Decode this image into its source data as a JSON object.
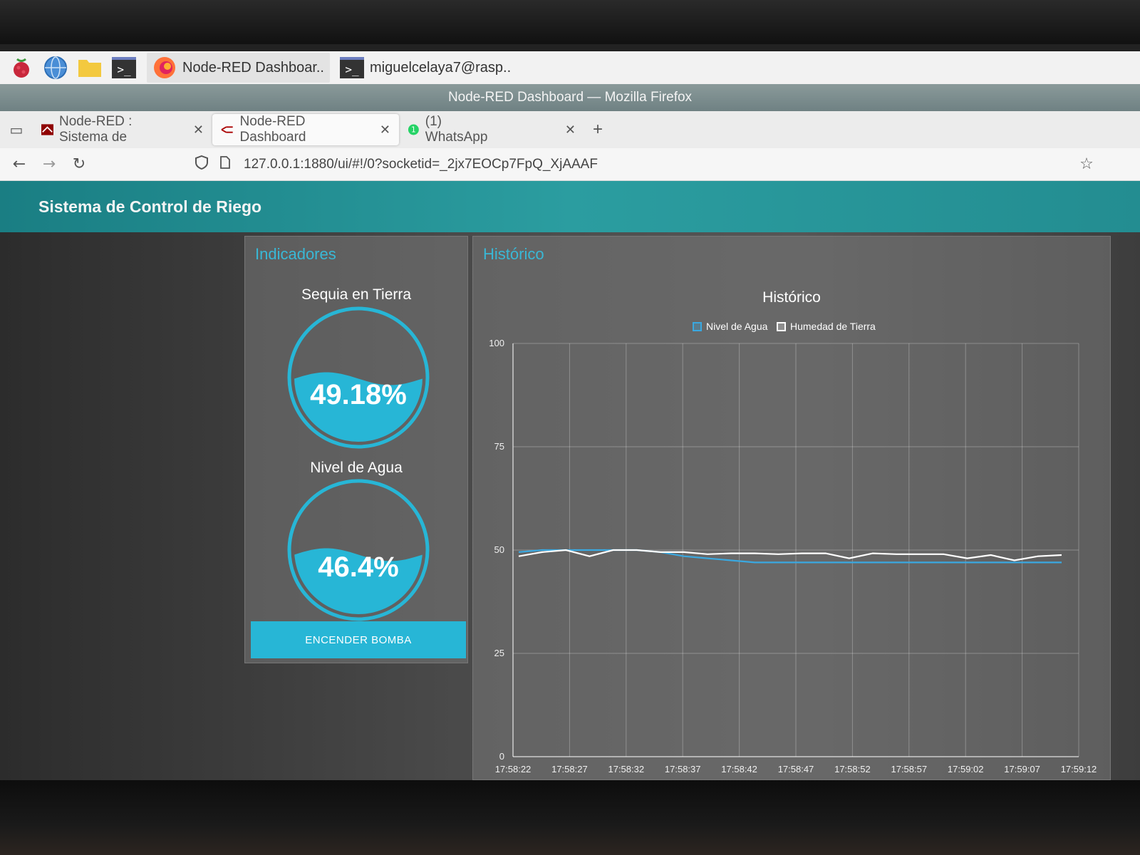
{
  "taskbar": {
    "firefox_item": "Node-RED Dashboar..",
    "terminal_item": "miguelcelaya7@rasp.."
  },
  "window_title": "Node-RED Dashboard — Mozilla Firefox",
  "tabs": [
    {
      "label": "Node-RED : Sistema de"
    },
    {
      "label": "Node-RED Dashboard"
    },
    {
      "label": "(1) WhatsApp"
    }
  ],
  "url": "127.0.0.1:1880/ui/#!/0?socketid=_2jx7EOCp7FpQ_XjAAAF",
  "dashboard": {
    "title": "Sistema de Control de Riego",
    "indicators_title": "Indicadores",
    "gauges": [
      {
        "label": "Sequia en Tierra",
        "value": "49.18%",
        "level": 49.18
      },
      {
        "label": "Nivel de Agua",
        "value": "46.4%",
        "level": 46.4
      }
    ],
    "pump_button": "ENCENDER BOMBA",
    "history_group_title": "Histórico"
  },
  "colors": {
    "accent": "#27b6d6",
    "header": "#2b9da0",
    "series_agua": "#3aa8e0",
    "series_tierra": "#ffffff"
  },
  "chart_data": {
    "type": "line",
    "title": "Histórico",
    "xlabel": "",
    "ylabel": "",
    "ylim": [
      0,
      100
    ],
    "yticks": [
      0,
      25,
      50,
      75,
      100
    ],
    "grid": true,
    "legend": "top-center",
    "x_ticks": [
      "17:58:22",
      "17:58:27",
      "17:58:32",
      "17:58:37",
      "17:58:42",
      "17:58:47",
      "17:58:52",
      "17:58:57",
      "17:59:02",
      "17:59:07",
      "17:59:12"
    ],
    "series": [
      {
        "name": "Nivel de Agua",
        "values": [
          49.5,
          50,
          50,
          50,
          50,
          50,
          49.5,
          48.5,
          48,
          47.5,
          47,
          47,
          47,
          47,
          47,
          47,
          47,
          47,
          47,
          47,
          47,
          47,
          47,
          47
        ]
      },
      {
        "name": "Humedad de Tierra",
        "values": [
          48.5,
          49.5,
          50,
          48.5,
          50,
          50,
          49.5,
          49.5,
          49,
          49.2,
          49.2,
          49,
          49.2,
          49.2,
          48,
          49.2,
          49,
          49,
          49,
          48,
          48.8,
          47.5,
          48.5,
          48.8
        ]
      }
    ]
  }
}
